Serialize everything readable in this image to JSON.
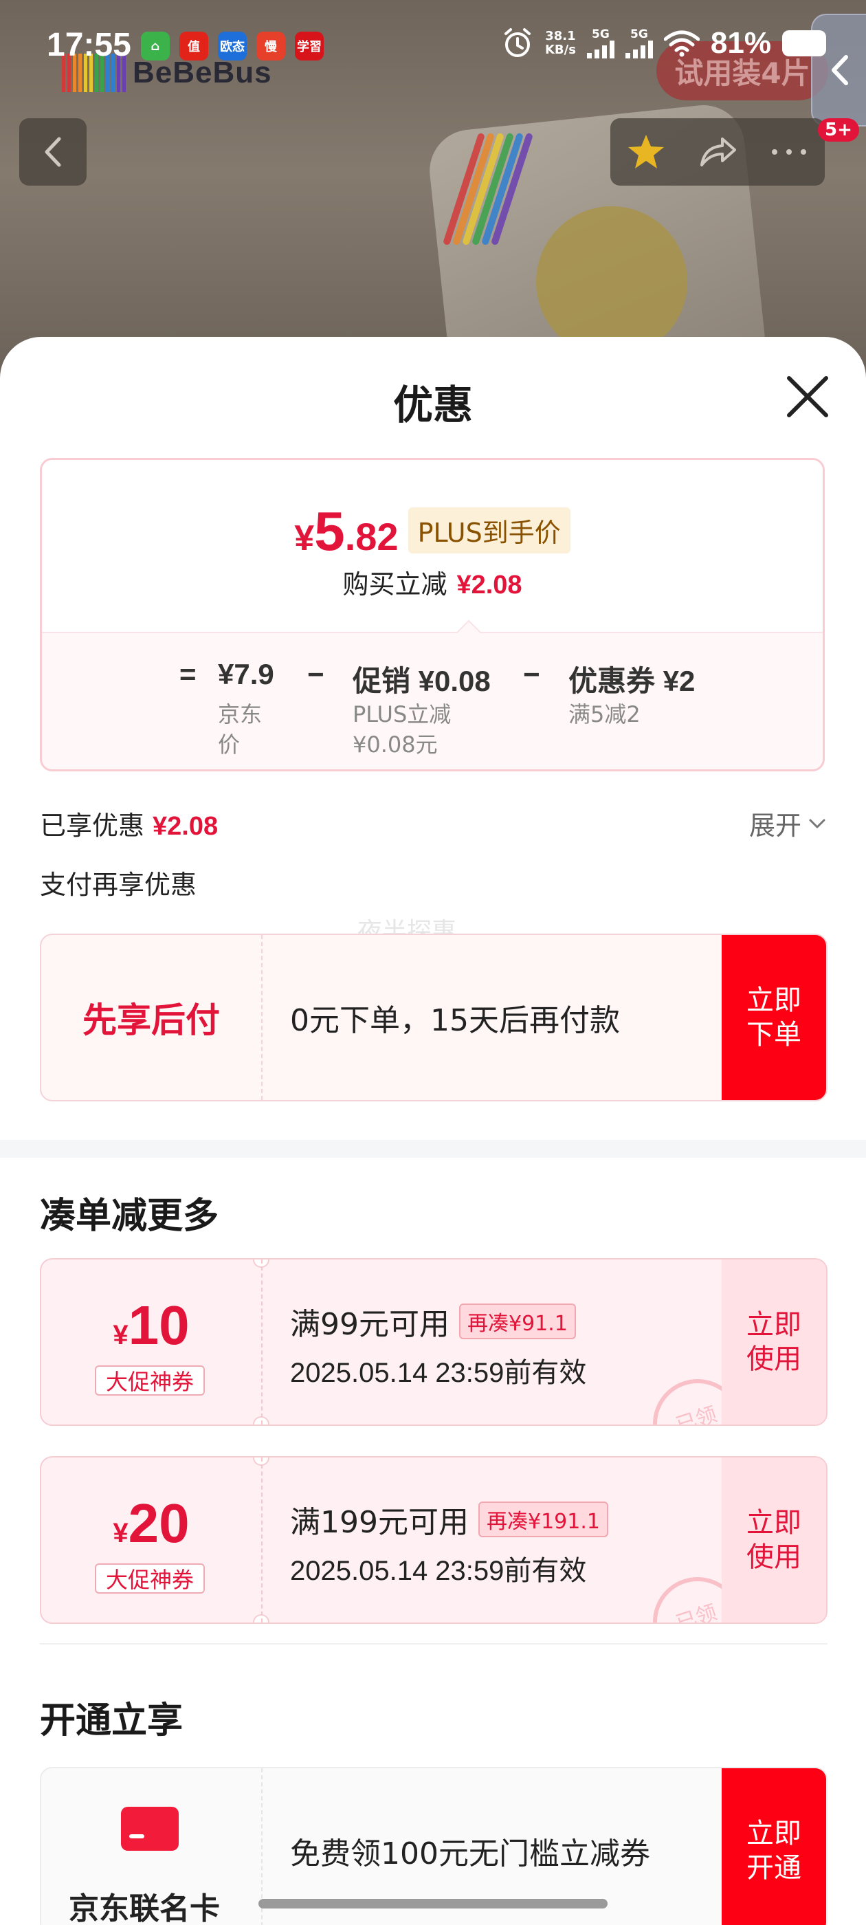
{
  "status_bar": {
    "time": "17:55",
    "app_icons": [
      {
        "name": "home-app-icon",
        "label": "⌂",
        "color": "#3bb34a"
      },
      {
        "name": "zhi-app-icon",
        "label": "值",
        "color": "#e2231a"
      },
      {
        "name": "oumao-app-icon",
        "label": "欧态",
        "color": "#1e6fd9"
      },
      {
        "name": "man-app-icon",
        "label": "慢",
        "color": "#e6402b"
      },
      {
        "name": "xuexi-app-icon",
        "label": "学習",
        "color": "#d7141a"
      }
    ],
    "net_speed": "38.1",
    "net_unit": "KB/s",
    "sim1": "5G",
    "sim2": "5G",
    "battery": "81%"
  },
  "background": {
    "brand": "BeBeBus",
    "trial_badge": "试用装4片",
    "cart_count": "5+",
    "rainbow_colors": [
      "#d23a3a",
      "#e8872b",
      "#e6c532",
      "#3aa24a",
      "#2f7fd0",
      "#6a3fb0"
    ]
  },
  "sheet": {
    "title": "优惠",
    "price_card": {
      "currency": "¥",
      "final_int": "5",
      "final_dec": ".82",
      "plus_tag": "PLUS到手价",
      "reduce_label": "购买立减",
      "reduce_value": "¥2.08",
      "eq": "=",
      "minus": "−",
      "jd_price": "¥7.9",
      "jd_label": "京东价",
      "promo_title": "促销 ¥0.08",
      "promo_sub": "PLUS立减¥0.08元",
      "coupon_title": "优惠券 ¥2",
      "coupon_sub": "满5减2"
    },
    "enjoyed_label": "已享优惠",
    "enjoyed_value": "¥2.08",
    "expand_label": "展开",
    "pay_more_label": "支付再享优惠",
    "watermark": "夜半探惠",
    "bnpl": {
      "title": "先享后付",
      "desc": "0元下单，15天后再付款",
      "button": "立即下单"
    },
    "bundle_title": "凑单减更多",
    "coupons": [
      {
        "currency": "¥",
        "amount": "10",
        "tag": "大促神券",
        "condition": "满99元可用",
        "need": "再凑¥91.1",
        "valid": "2025.05.14 23:59前有效",
        "button": "立即使用",
        "stamp": "已领"
      },
      {
        "currency": "¥",
        "amount": "20",
        "tag": "大促神券",
        "condition": "满199元可用",
        "need": "再凑¥191.1",
        "valid": "2025.05.14 23:59前有效",
        "button": "立即使用",
        "stamp": "已领"
      }
    ],
    "open_title": "开通立享",
    "member": {
      "name": "京东联名卡",
      "desc": "免费领100元无门槛立减券",
      "button": "立即开通"
    }
  }
}
